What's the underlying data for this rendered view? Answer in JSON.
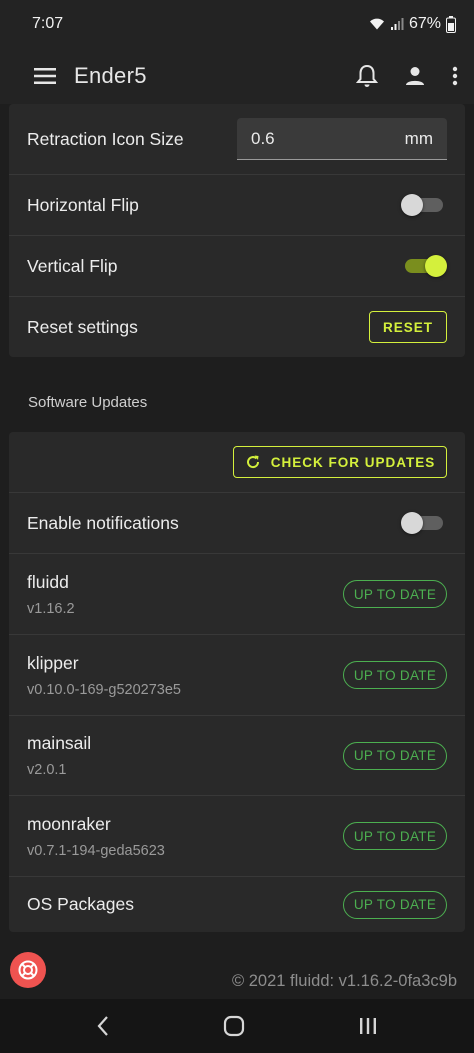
{
  "status_bar": {
    "time": "7:07",
    "battery": "67%"
  },
  "app_bar": {
    "title": "Ender5"
  },
  "display_settings": {
    "retraction_icon_size": {
      "label": "Retraction Icon Size",
      "value": "0.6",
      "unit": "mm"
    },
    "horizontal_flip": {
      "label": "Horizontal Flip",
      "on": false
    },
    "vertical_flip": {
      "label": "Vertical Flip",
      "on": true
    },
    "reset": {
      "label": "Reset settings",
      "button": "RESET"
    }
  },
  "software_updates": {
    "section_title": "Software Updates",
    "check_button": "CHECK FOR UPDATES",
    "notifications": {
      "label": "Enable notifications",
      "on": false
    },
    "components": [
      {
        "name": "fluidd",
        "version": "v1.16.2",
        "status": "UP TO DATE"
      },
      {
        "name": "klipper",
        "version": "v0.10.0-169-g520273e5",
        "status": "UP TO DATE"
      },
      {
        "name": "mainsail",
        "version": "v2.0.1",
        "status": "UP TO DATE"
      },
      {
        "name": "moonraker",
        "version": "v0.7.1-194-geda5623",
        "status": "UP TO DATE"
      },
      {
        "name": "OS Packages",
        "version": "",
        "status": "UP TO DATE"
      }
    ]
  },
  "footer": {
    "copyright": "© 2021 fluidd: v1.16.2-0fa3c9b"
  },
  "colors": {
    "accent": "#d4f03c",
    "success": "#4caf50",
    "fab": "#ef5350",
    "card": "#292929",
    "background": "#1e1e1e"
  },
  "icons": [
    "wifi-icon",
    "signal-icon",
    "battery-icon",
    "menu-icon",
    "bell-icon",
    "account-icon",
    "more-vert-icon",
    "refresh-icon",
    "lifebuoy-icon",
    "back-icon",
    "home-icon",
    "recents-icon"
  ]
}
